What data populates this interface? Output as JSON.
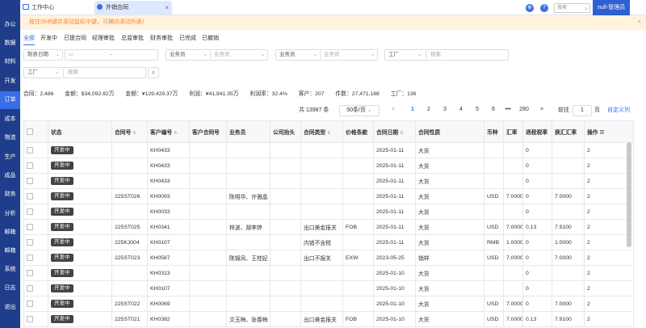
{
  "sidebar": {
    "items": [
      "办公",
      "数据",
      "材料",
      "开发",
      "订单",
      "成本",
      "物流",
      "生产",
      "成品",
      "财务",
      "分析",
      "邮箱",
      "邮箱",
      "系统",
      "日志",
      "退出"
    ]
  },
  "tabs": [
    {
      "label": "工作中心"
    },
    {
      "label": "外销合同",
      "close": "×"
    }
  ],
  "topbar": {
    "globe_icon": "globe-icon",
    "help_icon": "?",
    "search_placeholder": "搜索",
    "user": "null-管理员"
  },
  "notice": {
    "text": "按住Shift键并滚动鼠标中键，可横向滚动列表！",
    "close": "×"
  },
  "status_tabs": [
    "全部",
    "开发中",
    "已提合同",
    "经理审批",
    "总监审批",
    "财务审批",
    "已完成",
    "已撤销"
  ],
  "filters": {
    "date_label": "制表日期",
    "date_sep": "-",
    "salesperson1": "业务员",
    "salesperson1_ph": "业务员",
    "salesperson2": "业务员",
    "salesperson2_ph": "业务员",
    "factory1": "工厂",
    "factory1_ph": "搜索",
    "factory2": "工厂",
    "factory2_ph": "搜索"
  },
  "summary": [
    "合同：2,486",
    "金额：$34,092.82万",
    "金额：¥129,429.37万",
    "利润：¥41,941.35万",
    "利润率：32.4%",
    "客户：207",
    "件数：27,471,188",
    "工厂：136"
  ],
  "pagination": {
    "total": "共 13987 条",
    "page_size": "50条/页",
    "prev": "<",
    "pages": [
      "1",
      "2",
      "3",
      "4",
      "5",
      "6",
      "•••",
      "280"
    ],
    "next": ">",
    "goto_label": "前往",
    "goto_value": "1",
    "page_unit": "页",
    "custom_cols": "自定义列"
  },
  "table": {
    "headers": [
      "",
      "状态",
      "合同号",
      "客户编号",
      "客户合同号",
      "业务员",
      "公司抬头",
      "合同类型",
      "价格条款",
      "合同日期",
      "合同性质",
      "币种",
      "汇率",
      "退税税率",
      "换汇汇率",
      "操作"
    ],
    "rows": [
      [
        "",
        "开发中",
        "",
        "KH0433",
        "",
        "",
        "",
        "",
        "",
        "2025-01-11",
        "大货",
        "",
        "",
        "0",
        "",
        "2"
      ],
      [
        "",
        "开发中",
        "",
        "KH0433",
        "",
        "",
        "",
        "",
        "",
        "2025-01-11",
        "大货",
        "",
        "",
        "0",
        "",
        "2"
      ],
      [
        "",
        "开发中",
        "",
        "KH0433",
        "",
        "",
        "",
        "",
        "",
        "2025-01-11",
        "大货",
        "",
        "",
        "0",
        "",
        "2"
      ],
      [
        "",
        "开发中",
        "225ST026",
        "KH0093",
        "",
        "陈明华、许雅晶",
        "",
        "",
        "",
        "2025-01-11",
        "大货",
        "USD",
        "7.0000",
        "0",
        "7.0000",
        "2"
      ],
      [
        "",
        "开发中",
        "",
        "KH0033",
        "",
        "",
        "",
        "",
        "",
        "2025-01-11",
        "大货",
        "",
        "",
        "0",
        "",
        "2"
      ],
      [
        "",
        "开发中",
        "225ST025",
        "KH0341",
        "",
        "林波、胡李婷",
        "",
        "出口美金报关",
        "FOB",
        "2025-01-11",
        "大货",
        "USD",
        "7.0000",
        "0.13",
        "7.9100",
        "2"
      ],
      [
        "",
        "开发中",
        "225KJ004",
        "KH0107",
        "",
        "",
        "",
        "内销不含税",
        "",
        "2025-01-11",
        "大货",
        "RMB",
        "1.0000",
        "0",
        "1.0000",
        "2"
      ],
      [
        "",
        "开发中",
        "225ST023",
        "KH0587",
        "",
        "陈锦凤、王桂妃",
        "",
        "出口不报关",
        "EXW",
        "2023-05-25",
        "销样",
        "USD",
        "7.0000",
        "0",
        "7.0000",
        "2"
      ],
      [
        "",
        "开发中",
        "",
        "KH0313",
        "",
        "",
        "",
        "",
        "",
        "2025-01-10",
        "大货",
        "",
        "",
        "0",
        "",
        "2"
      ],
      [
        "",
        "开发中",
        "",
        "KH0107",
        "",
        "",
        "",
        "",
        "",
        "2025-01-10",
        "大货",
        "",
        "",
        "0",
        "",
        "2"
      ],
      [
        "",
        "开发中",
        "225ST022",
        "KH0069",
        "",
        "",
        "",
        "",
        "",
        "2025-01-10",
        "大货",
        "USD",
        "7.0000",
        "0",
        "7.0000",
        "2"
      ],
      [
        "",
        "开发中",
        "225ST021",
        "KH0382",
        "",
        "文玉梅、张春梅",
        "",
        "出口美金报关",
        "FOB",
        "2025-01-10",
        "大货",
        "USD",
        "7.0000",
        "0.13",
        "7.9100",
        "2"
      ]
    ]
  }
}
